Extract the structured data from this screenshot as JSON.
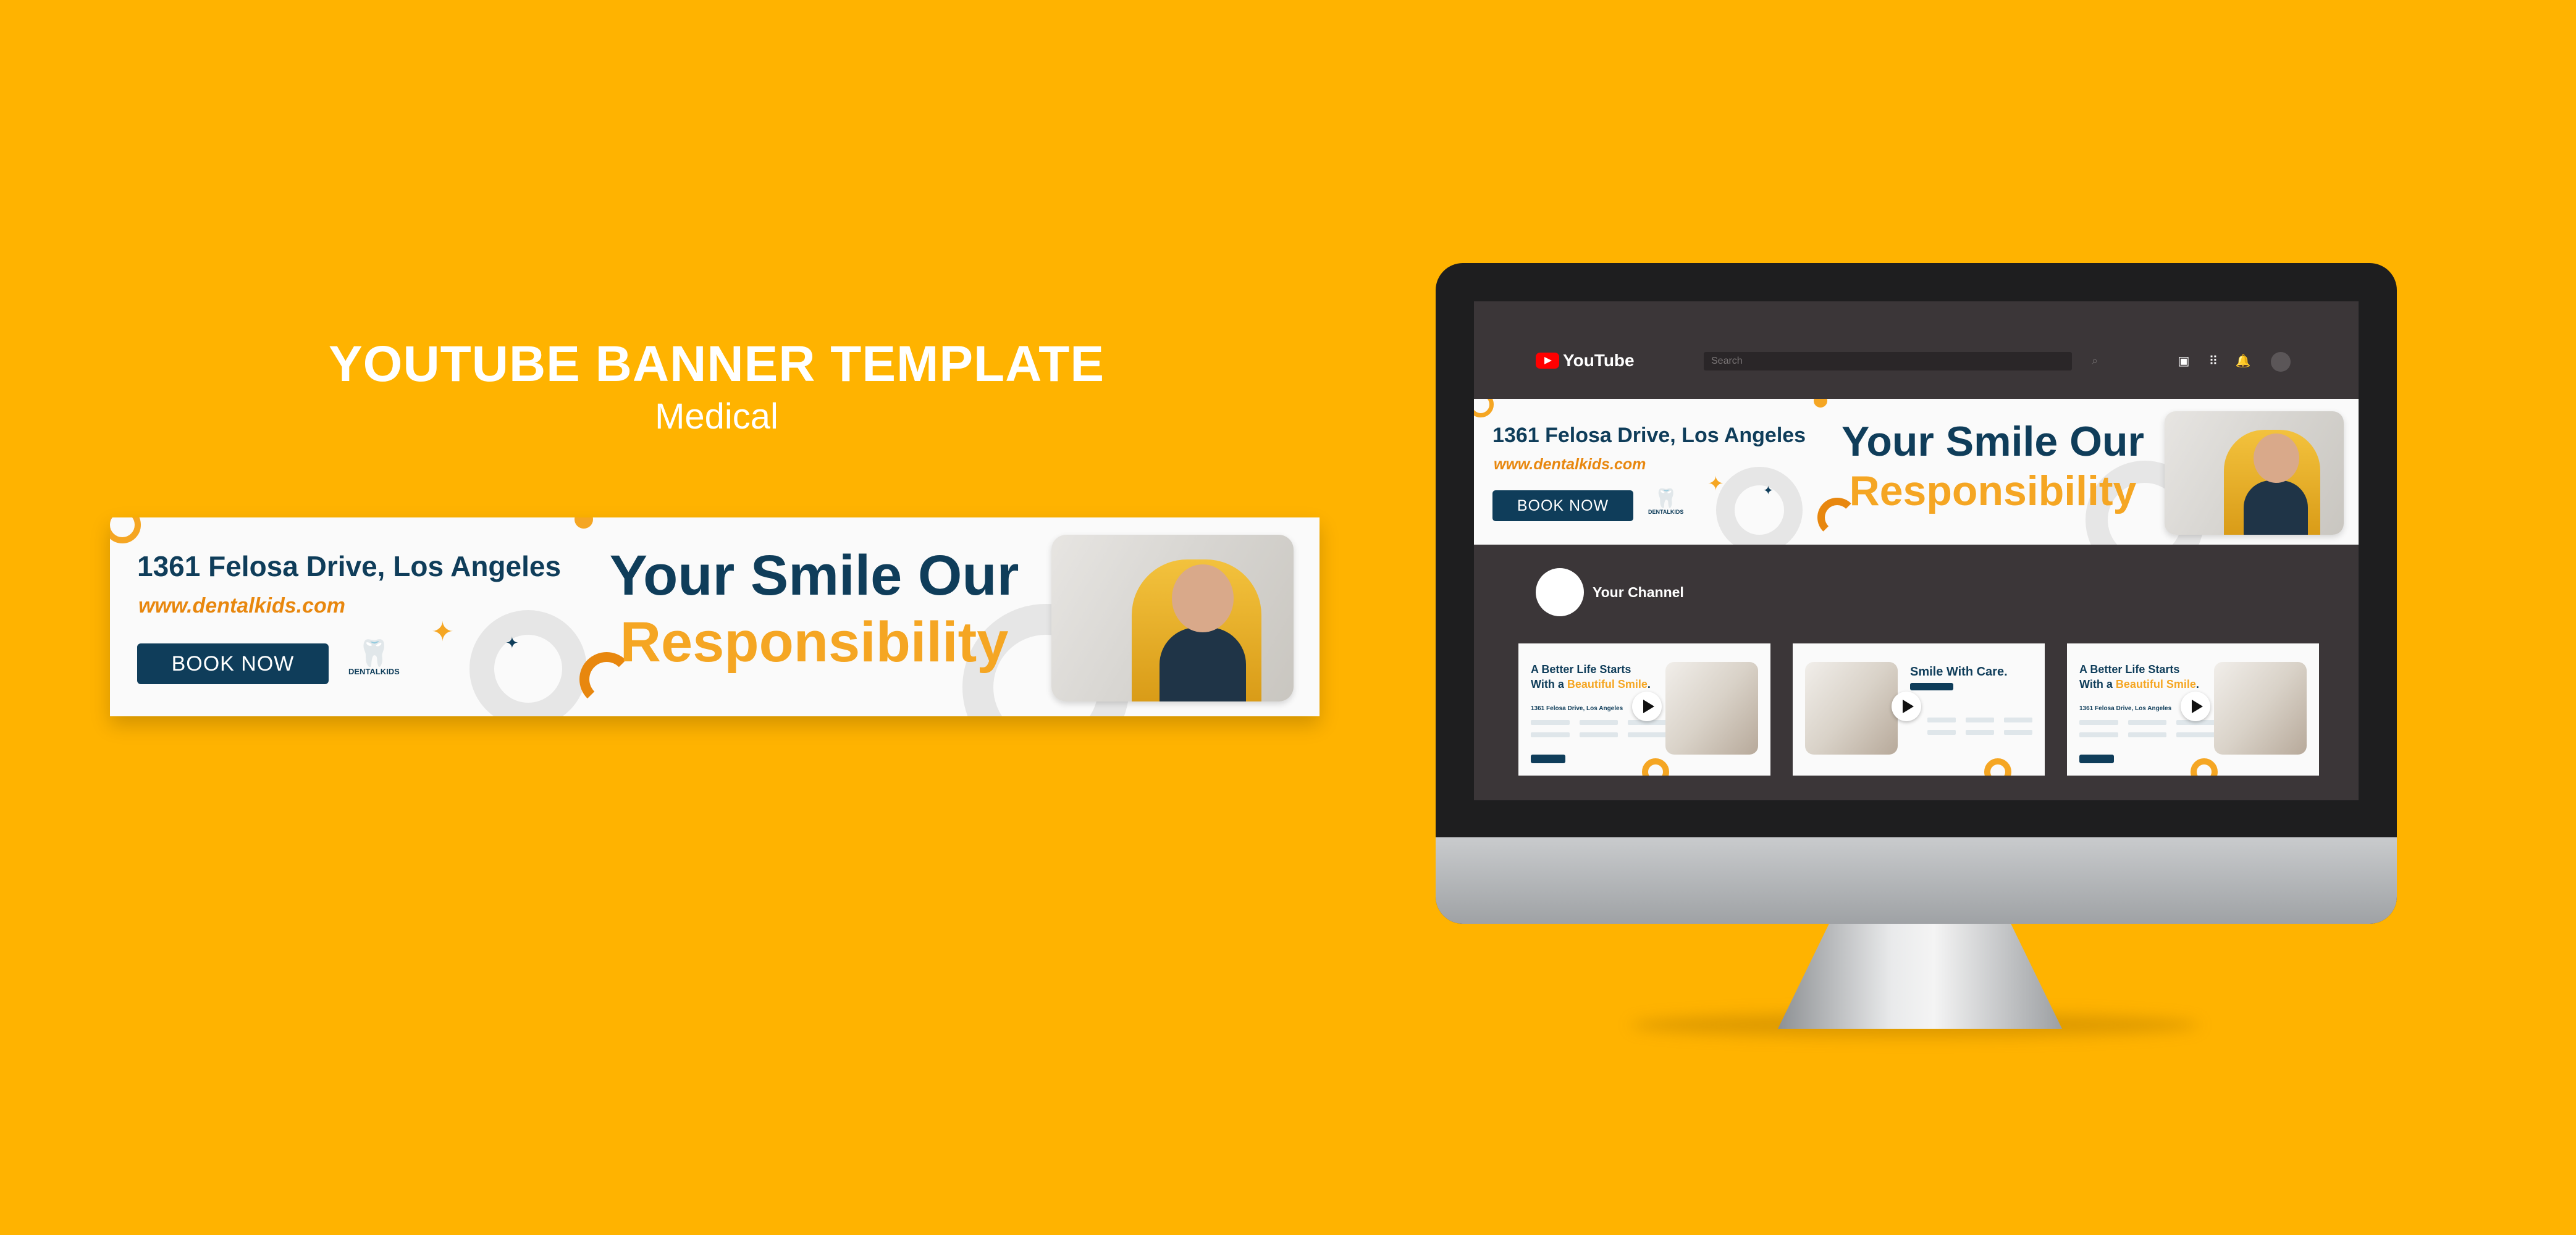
{
  "heading": {
    "title": "YOUTUBE BANNER TEMPLATE",
    "subtitle": "Medical"
  },
  "banner": {
    "address": "1361 Felosa Drive, Los Angeles",
    "url": "www.dentalkids.com",
    "book_label": "BOOK NOW",
    "logo_text": "DENTALKIDS",
    "headline_1": "Your Smile Our",
    "headline_2": "Responsibility"
  },
  "youtube": {
    "brand": "YouTube",
    "search_placeholder": "Search",
    "channel_name": "Your Channel"
  },
  "thumbnails": [
    {
      "line1": "A Better Life Starts",
      "line2_pre": "With a ",
      "line2_accent": "Beautiful Smile",
      "line2_post": ".",
      "address": "1361 Felosa Drive, Los Angeles"
    },
    {
      "line1": "Smile With Care.",
      "line2_pre": "",
      "line2_accent": "",
      "line2_post": "",
      "address": ""
    },
    {
      "line1": "A Better Life Starts",
      "line2_pre": "With a ",
      "line2_accent": "Beautiful Smile",
      "line2_post": ".",
      "address": "1361 Felosa Drive, Los Angeles"
    }
  ],
  "colors": {
    "background": "#FFB300",
    "navy": "#0f3d5a",
    "orange_text": "#e8870e",
    "gold": "#f5a623",
    "screen": "#3b3638",
    "youtube_red": "#ff0000"
  },
  "icons": [
    "youtube-play-icon",
    "search-icon",
    "create-video-icon",
    "apps-grid-icon",
    "bell-icon",
    "tooth-icon",
    "sparkle-icon",
    "play-icon"
  ]
}
